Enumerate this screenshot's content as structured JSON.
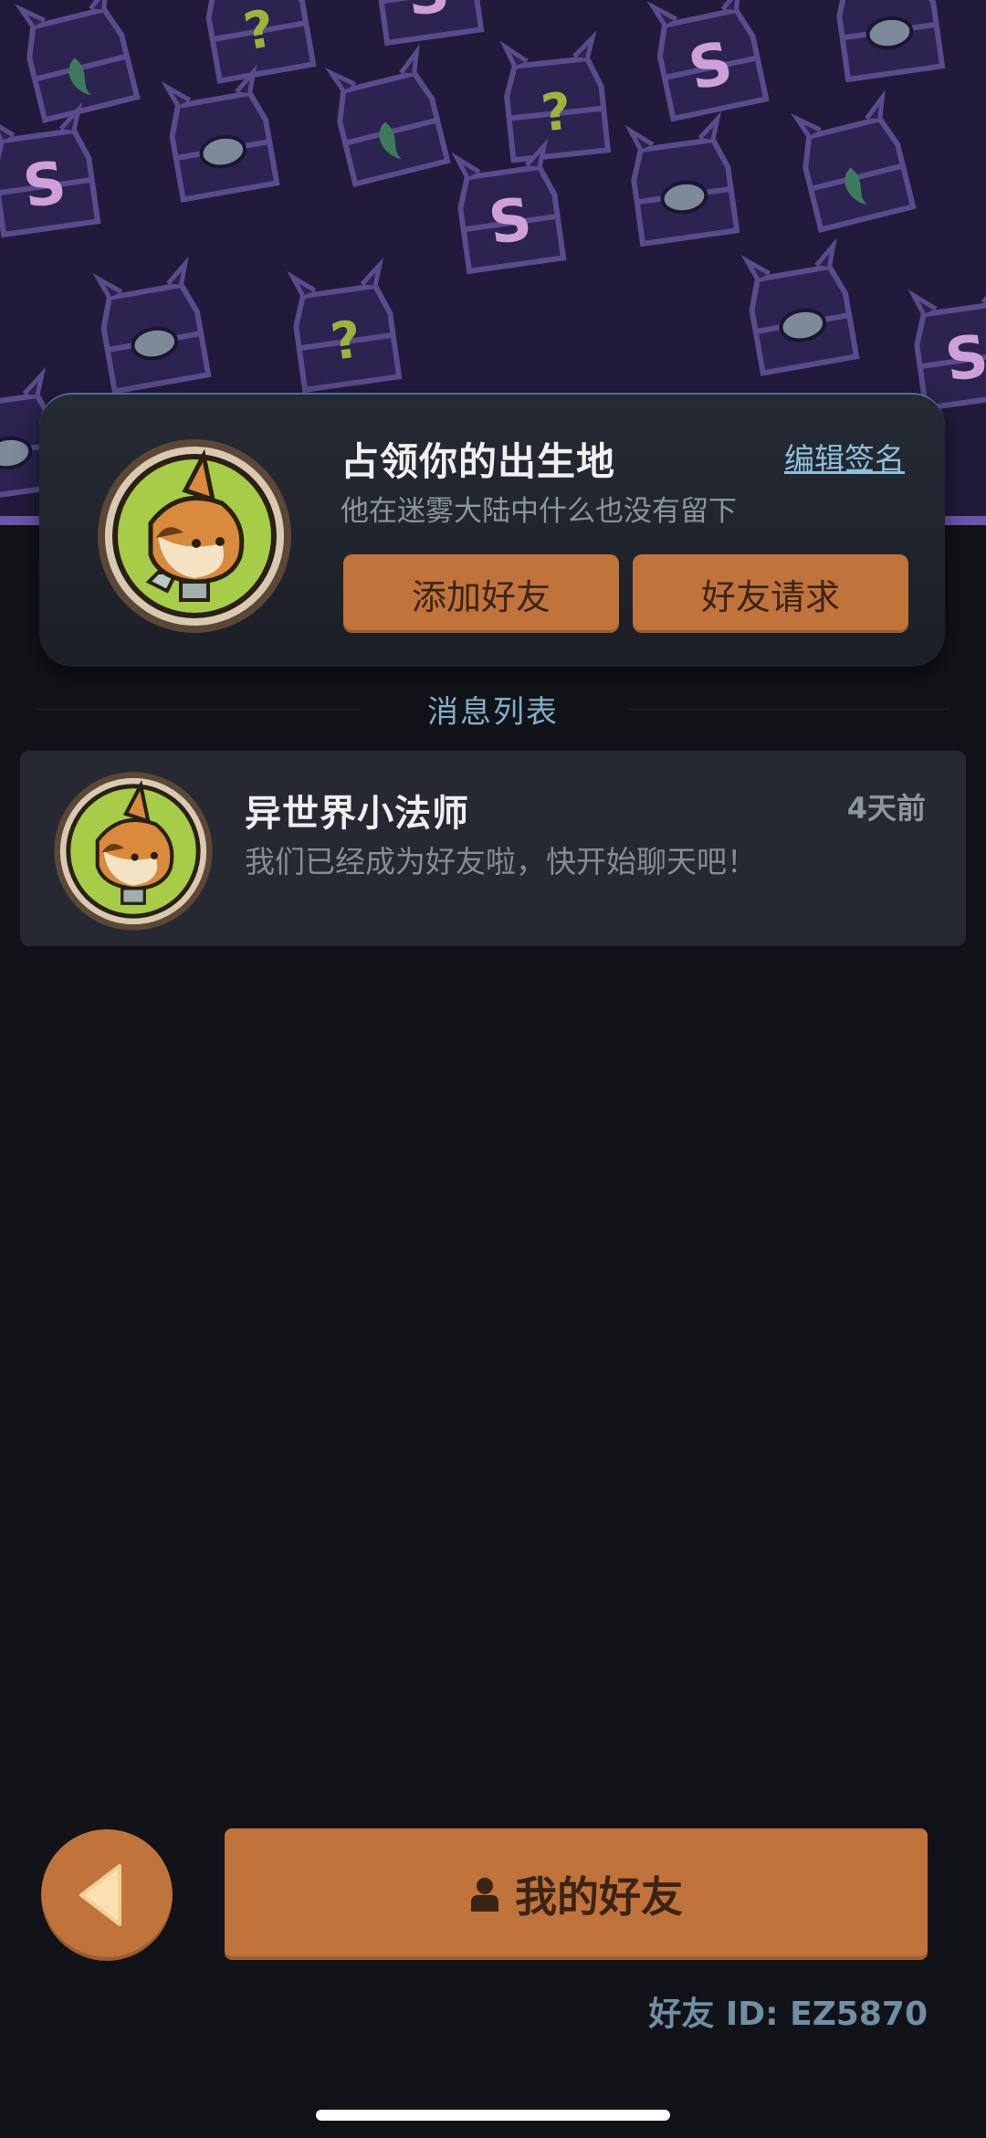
{
  "colors": {
    "background": "#121318",
    "banner": "#221a3a",
    "accent_orange": "#c0733a",
    "link_blue": "#8cc0dc",
    "section_title": "#7fb0c6"
  },
  "profile": {
    "name": "占领你的出生地",
    "edit_link": "编辑签名",
    "signature": "他在迷雾大陆中什么也没有留下",
    "add_friend_label": "添加好友",
    "friend_requests_label": "好友请求",
    "avatar_icon": "fox-avatar-icon"
  },
  "messages": {
    "section_title": "消息列表",
    "items": [
      {
        "name": "异世界小法师",
        "time": "4天前",
        "text": "我们已经成为好友啦，快开始聊天吧！",
        "avatar_icon": "fox-avatar-icon"
      }
    ]
  },
  "footer": {
    "back_icon": "back-triangle-icon",
    "my_friends_label": "我的好友",
    "my_friends_icon": "person-icon",
    "friend_id": "好友 ID: EZ5870"
  }
}
